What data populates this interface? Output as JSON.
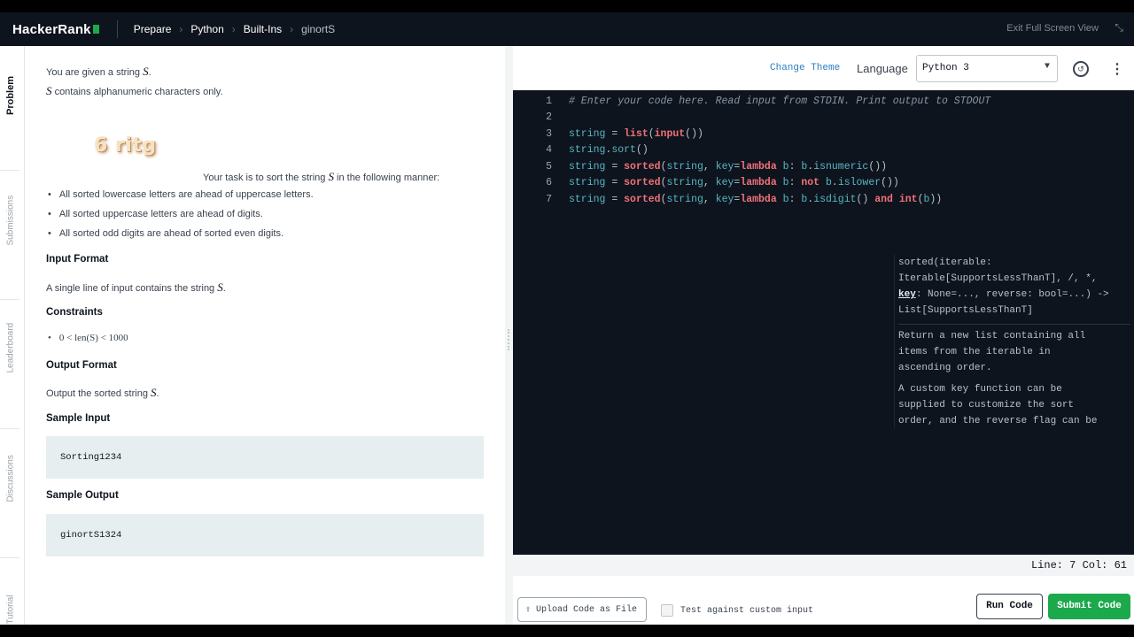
{
  "app": {
    "logo": "HackerRank",
    "breadcrumbs": [
      "Prepare",
      "Python",
      "Built-Ins",
      "ginortS"
    ],
    "exit_full_screen": "Exit Full Screen View"
  },
  "rail_tabs": [
    "Problem",
    "Submissions",
    "Leaderboard",
    "Discussions",
    "Tutorial"
  ],
  "problem": {
    "intro_1": "You are given a string",
    "intro_1_var": "S",
    "intro_2_var": "S",
    "intro_2": "contains alphanumeric characters only.",
    "image_text": "6 ritg",
    "task_pre": "Your task is to sort the string",
    "task_var": "S",
    "task_post": "in the following manner:",
    "rules": [
      "All sorted lowercase letters are ahead of uppercase letters.",
      "All sorted uppercase letters are ahead of digits.",
      "All sorted odd digits are ahead of sorted even digits."
    ],
    "input_format_heading": "Input Format",
    "input_format_text": "A single line of input contains the string",
    "input_format_var": "S",
    "constraints_heading": "Constraints",
    "constraint": "0 < len(S) < 1000",
    "output_format_heading": "Output Format",
    "output_format_text": "Output the sorted string",
    "output_format_var": "S",
    "sample_input_heading": "Sample Input",
    "sample_input": "Sorting1234",
    "sample_output_heading": "Sample Output",
    "sample_output": "ginortS1324"
  },
  "editor": {
    "change_theme": "Change Theme",
    "language_label": "Language",
    "language_value": "Python 3",
    "line_numbers": [
      "1",
      "2",
      "3",
      "4",
      "5",
      "6",
      "7"
    ],
    "comment": "# Enter your code here. Read input from STDIN. Print output to STDOUT",
    "status": "Line: 7 Col: 61",
    "tooltip": {
      "sig_1": "sorted(iterable:",
      "sig_2": "Iterable[SupportsLessThanT], /, *,",
      "sig_key": "key",
      "sig_3": ": None=..., reverse: bool=...) ->",
      "sig_4": "List[SupportsLessThanT]",
      "doc_1": "Return a new list containing all",
      "doc_2": "items from the iterable in",
      "doc_3": "ascending order.",
      "doc_4": "A custom key function can be",
      "doc_5": "supplied to customize the sort",
      "doc_6": "order, and the reverse flag can be"
    }
  },
  "footer": {
    "upload": "Upload Code as File",
    "custom_input": "Test against custom input",
    "run": "Run Code",
    "submit": "Submit Code"
  }
}
